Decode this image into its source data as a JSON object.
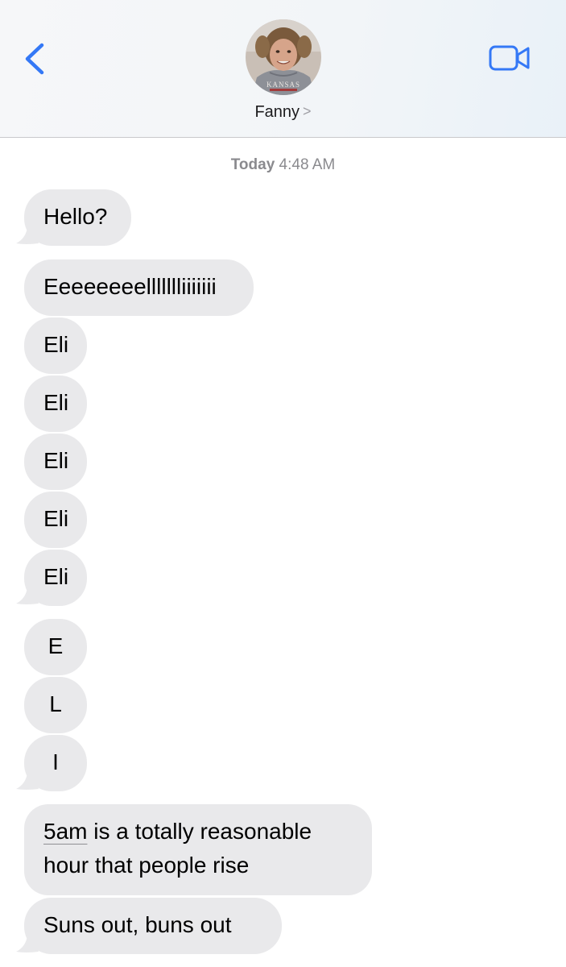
{
  "header": {
    "contact_name": "Fanny",
    "name_chevron": ">",
    "back_icon": "chevron-left-icon",
    "video_icon": "video-camera-icon",
    "avatar_shirt_text": "KANSAS",
    "accent_color": "#3478f6"
  },
  "thread": {
    "timestamp_day": "Today",
    "timestamp_time": "4:48 AM",
    "bubble_color": "#e9e9eb",
    "messages": [
      {
        "text": "Hello?"
      },
      {
        "text": "Eeeeeeeellllllliiiiiii"
      },
      {
        "text": "Eli"
      },
      {
        "text": "Eli"
      },
      {
        "text": "Eli"
      },
      {
        "text": "Eli"
      },
      {
        "text": "Eli"
      },
      {
        "text": "E"
      },
      {
        "text": "L"
      },
      {
        "text": "I"
      },
      {
        "link": "5am",
        "rest": " is a totally reasonable hour that people rise"
      },
      {
        "text": "Suns out, buns out"
      }
    ]
  }
}
